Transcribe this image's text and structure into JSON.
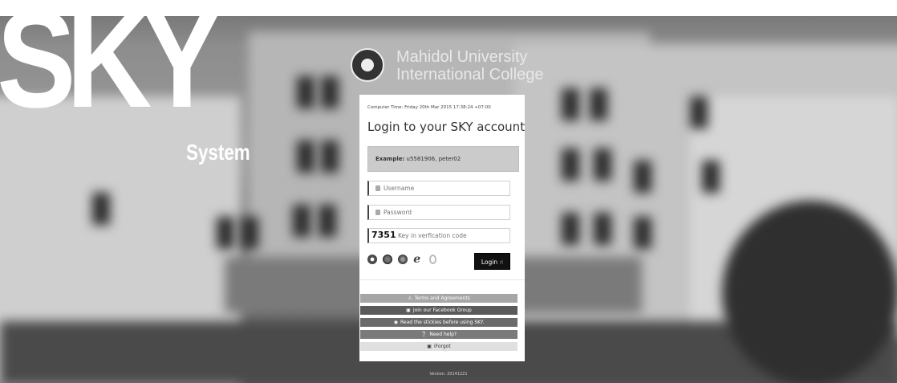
{
  "brand": {
    "wordmark": "SKY",
    "subtitle": "System"
  },
  "institution": {
    "line1": "Mahidol  University",
    "line2": "International College"
  },
  "card": {
    "computer_time": "Computer Time: Friday 20th Mar 2015 17:38:24 +07:00",
    "title": "Login to your SKY account",
    "example_label": "Example:",
    "example_value": "u5581906, peter02",
    "username_placeholder": "Username",
    "password_placeholder": "Password",
    "verification_code": "7351",
    "verification_placeholder": "Key in verfication code",
    "login_label": "Login",
    "browsers": [
      "chrome-icon",
      "safari-icon",
      "firefox-icon",
      "ie-icon",
      "opera-icon"
    ]
  },
  "links": {
    "terms": "Terms and Agreements",
    "facebook": "Join our Facebook Group",
    "stickies": "Read the stickies before using SKY.",
    "help": "Need help?",
    "forgot": "iForgot"
  },
  "footer": {
    "version": "Version: 20141221"
  }
}
